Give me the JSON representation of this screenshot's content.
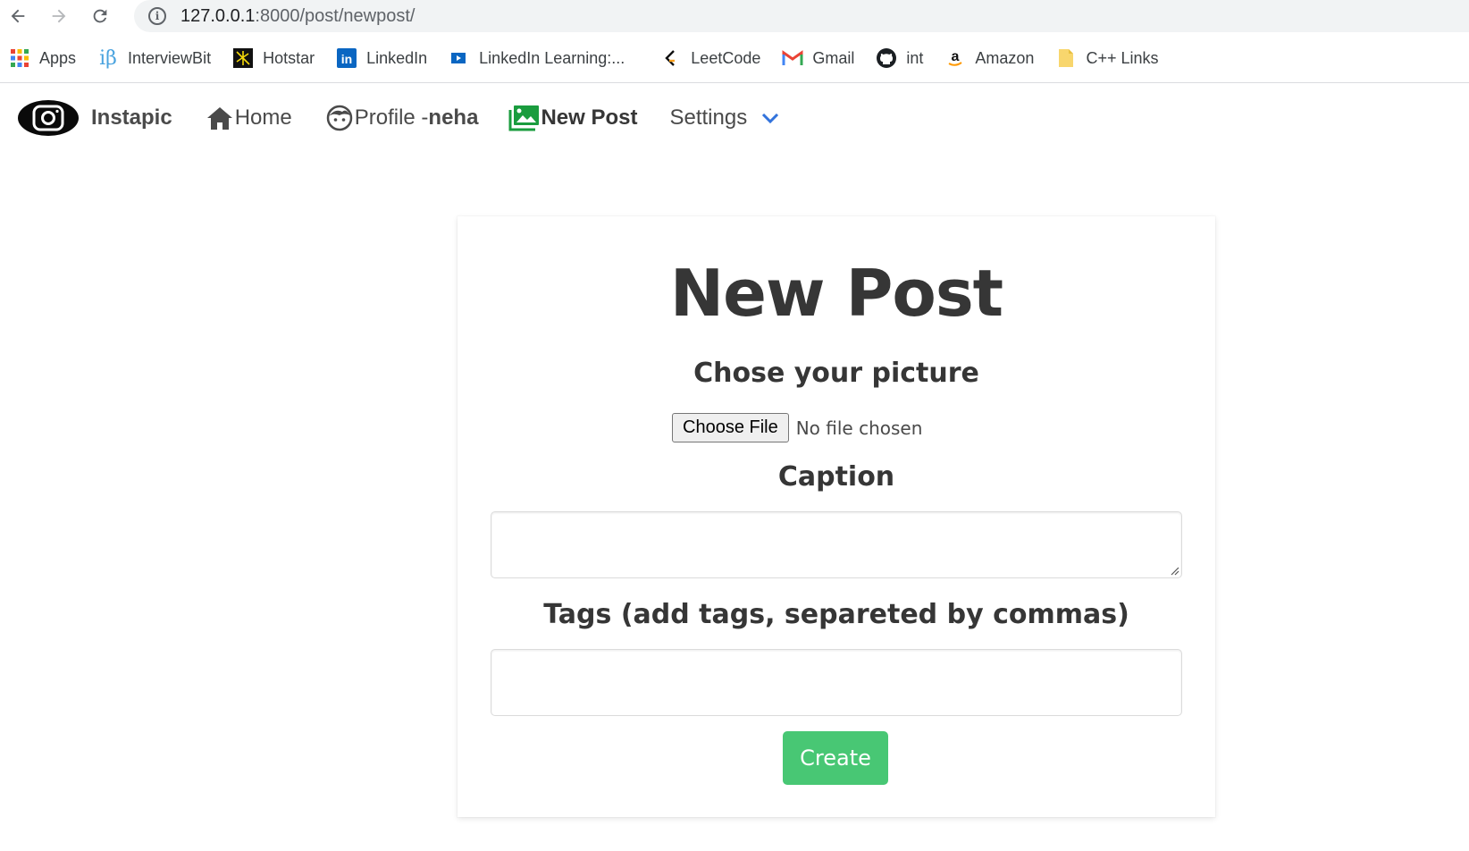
{
  "browser": {
    "url_host": "127.0.0.1",
    "url_path": ":8000/post/newpost/",
    "bookmarks": [
      {
        "label": "Apps",
        "icon": "apps-grid-icon"
      },
      {
        "label": "InterviewBit",
        "icon": "interviewbit-icon"
      },
      {
        "label": "Hotstar",
        "icon": "hotstar-icon"
      },
      {
        "label": "LinkedIn",
        "icon": "linkedin-icon"
      },
      {
        "label": "LinkedIn Learning:...",
        "icon": "linkedin-learning-icon"
      },
      {
        "label": "LeetCode",
        "icon": "leetcode-icon"
      },
      {
        "label": "Gmail",
        "icon": "gmail-icon"
      },
      {
        "label": "int",
        "icon": "github-icon"
      },
      {
        "label": "Amazon",
        "icon": "amazon-icon"
      },
      {
        "label": "C++ Links",
        "icon": "folder-icon"
      }
    ]
  },
  "navbar": {
    "brand": "Instapic",
    "home": "Home",
    "profile_prefix": "Profile -",
    "profile_user": "neha",
    "new_post": "New Post",
    "settings": "Settings"
  },
  "form": {
    "title": "New Post",
    "picture_label": "Chose your picture",
    "file_button": "Choose File",
    "file_status": "No file chosen",
    "caption_label": "Caption",
    "caption_value": "",
    "tags_label": "Tags (add tags, separeted by commas)",
    "tags_value": "",
    "submit": "Create"
  },
  "colors": {
    "accent_green": "#48c774",
    "settings_chevron": "#3273dc"
  }
}
